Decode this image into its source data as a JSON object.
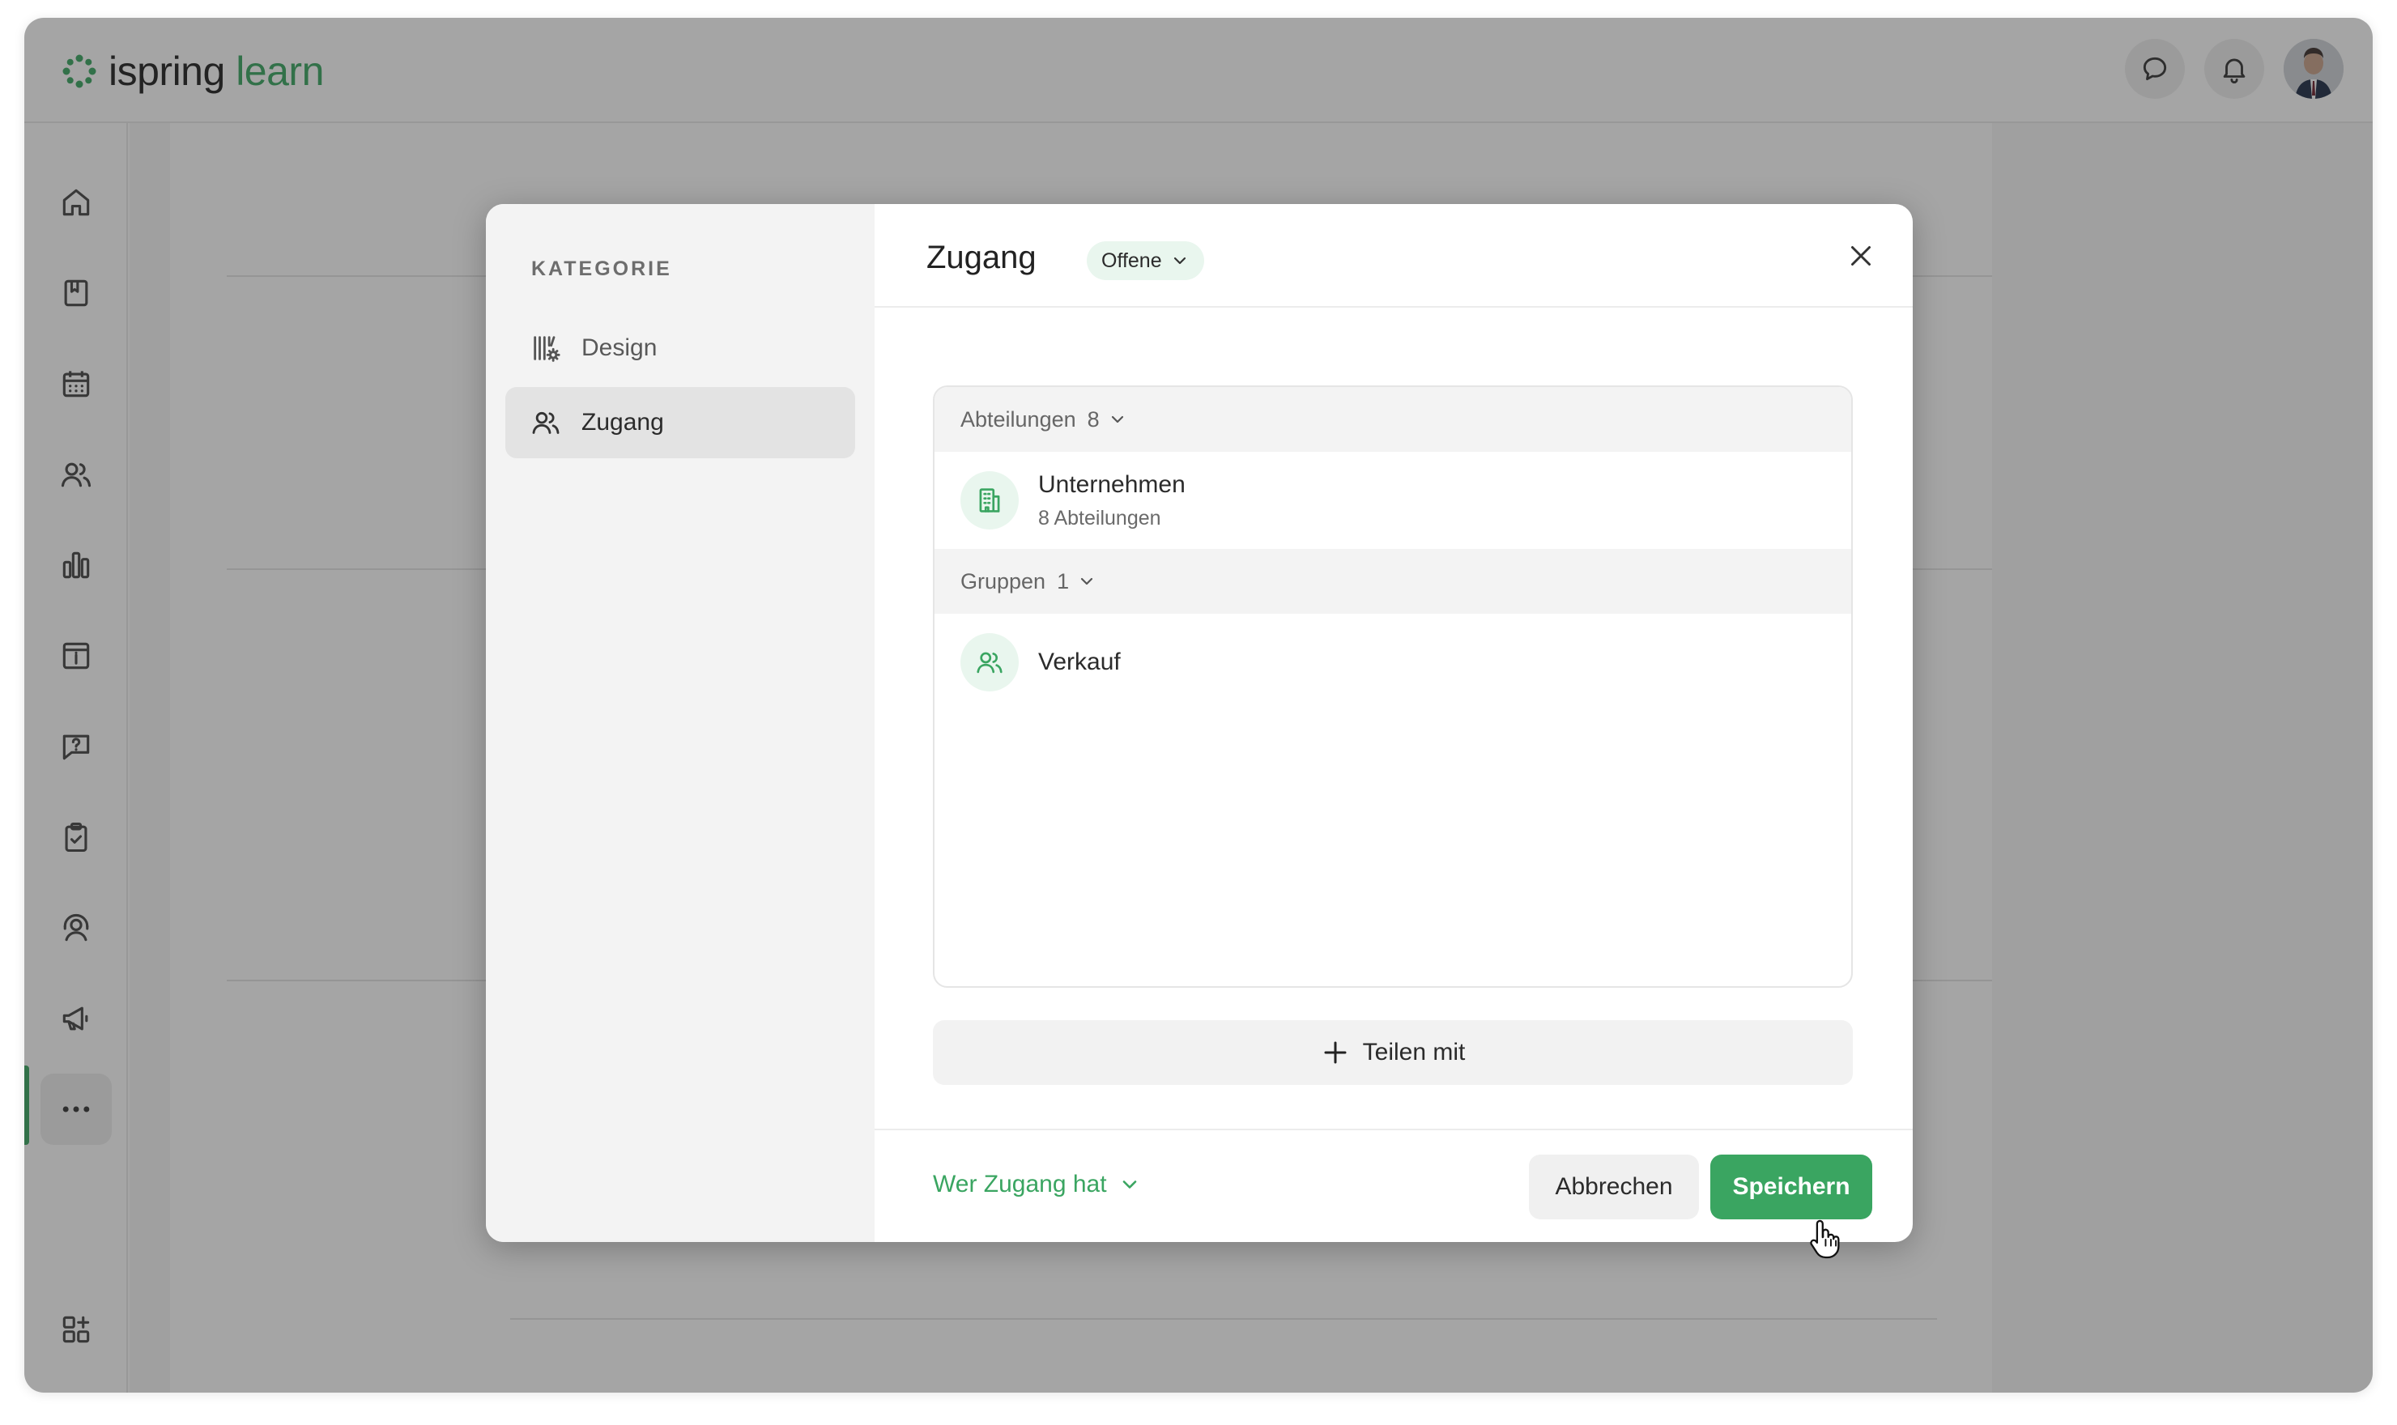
{
  "app": {
    "logo_brand": "ispring",
    "logo_product": "learn",
    "accent_color": "#3aa561"
  },
  "topbar": {
    "icons": [
      "chat-icon",
      "bell-icon",
      "user-avatar"
    ]
  },
  "sidebar": {
    "items": [
      {
        "icon": "home-icon"
      },
      {
        "icon": "book-icon"
      },
      {
        "icon": "calendar-icon"
      },
      {
        "icon": "users-icon"
      },
      {
        "icon": "bar-chart-icon"
      },
      {
        "icon": "info-panel-icon"
      },
      {
        "icon": "question-chat-icon"
      },
      {
        "icon": "clipboard-check-icon"
      },
      {
        "icon": "headset-user-icon"
      },
      {
        "icon": "megaphone-icon"
      },
      {
        "icon": "more-icon",
        "active": true
      },
      {
        "icon": "add-widget-icon"
      }
    ]
  },
  "modal": {
    "side_heading": "KATEGORIE",
    "side_items": [
      {
        "label": "Design",
        "icon": "design-settings-icon"
      },
      {
        "label": "Zugang",
        "icon": "users-icon",
        "active": true
      }
    ],
    "title": "Zugang",
    "access_badge": "Offene",
    "groups": [
      {
        "label": "Abteilungen",
        "count": "8",
        "rows": [
          {
            "title": "Unternehmen",
            "subtitle": "8 Abteilungen",
            "icon": "building-icon"
          }
        ]
      },
      {
        "label": "Gruppen",
        "count": "1",
        "rows": [
          {
            "title": "Verkauf",
            "icon": "users-icon"
          }
        ]
      }
    ],
    "share_label": "Teilen mit",
    "who_access_label": "Wer Zugang hat",
    "cancel_label": "Abbrechen",
    "save_label": "Speichern"
  }
}
